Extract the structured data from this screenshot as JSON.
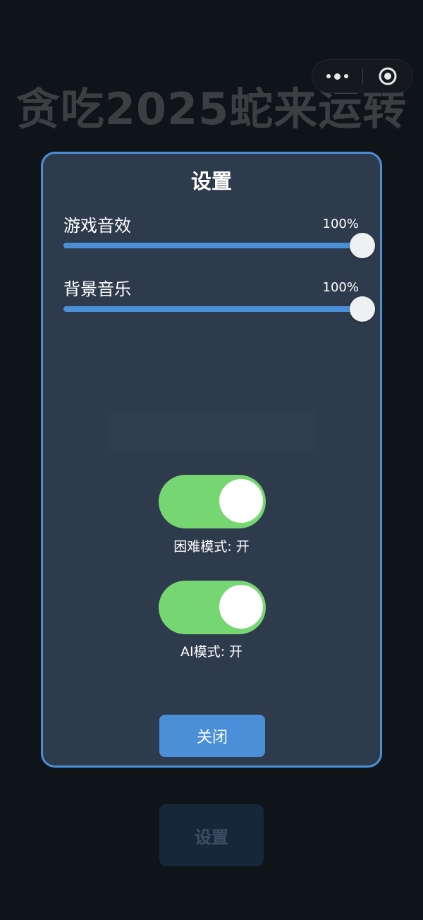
{
  "app": {
    "title": "贪吃2025蛇来运转"
  },
  "capsule": {
    "menu_icon": "more-dots-icon",
    "close_icon": "target-circle-icon"
  },
  "background": {
    "settings_button_label": "设置"
  },
  "settings_modal": {
    "title": "设置",
    "sliders": [
      {
        "label": "游戏音效",
        "value_text": "100%",
        "value": 1.0
      },
      {
        "label": "背景音乐",
        "value_text": "100%",
        "value": 1.0
      }
    ],
    "toggles": [
      {
        "label": "困难模式: 开",
        "on": true
      },
      {
        "label": "AI模式: 开",
        "on": true
      }
    ],
    "close_button_label": "关闭"
  },
  "colors": {
    "accent": "#4a8fd8",
    "toggle_on": "#76d672",
    "modal_bg": "#2e3b4c",
    "page_bg": "#0f1419"
  }
}
